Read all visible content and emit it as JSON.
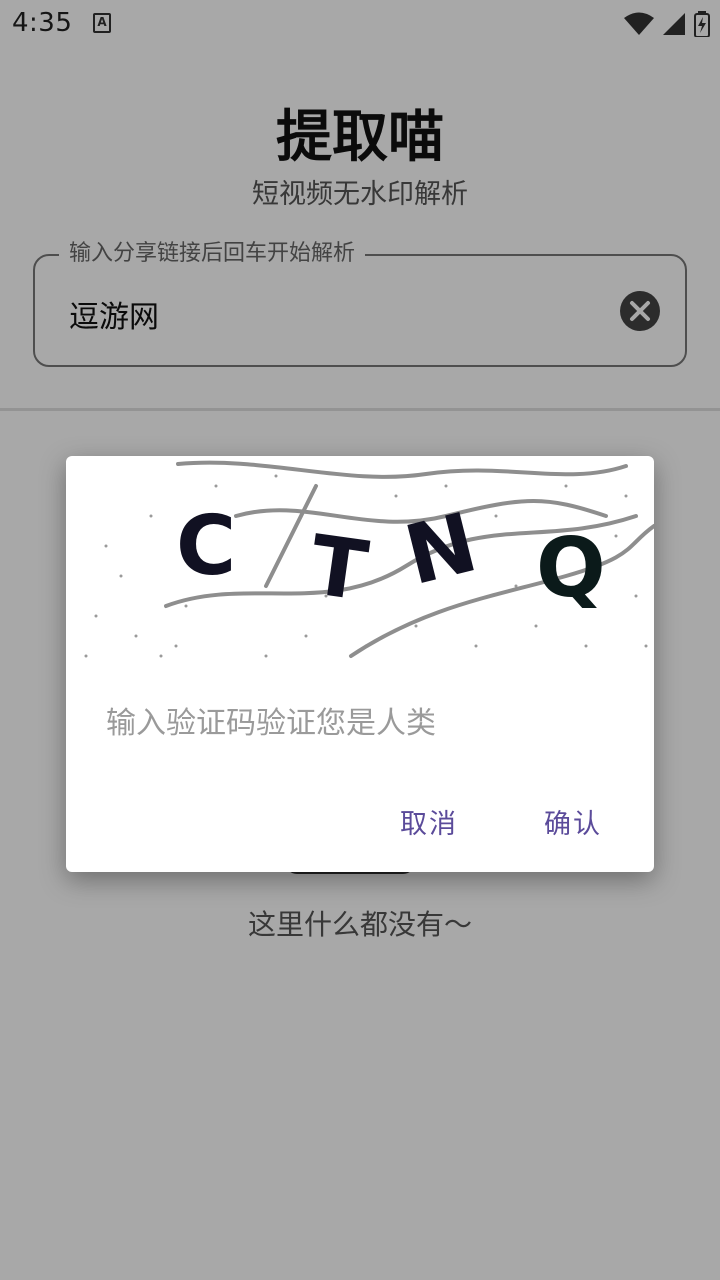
{
  "status_bar": {
    "time": "4:35",
    "notif_icon": "font-a-icon",
    "icons": [
      "wifi-icon",
      "signal-icon",
      "battery-charging-icon"
    ]
  },
  "app": {
    "title": "提取喵",
    "subtitle": "短视频无水印解析"
  },
  "link_field": {
    "label": "输入分享链接后回车开始解析",
    "value": "逗游网",
    "clear_icon": "clear-circle-icon"
  },
  "empty_state": {
    "text": "这里什么都没有～"
  },
  "dialog": {
    "captcha_text": "CTNQ",
    "captcha_letters": [
      "C",
      "T",
      "N",
      "Q"
    ],
    "input_placeholder": "输入验证码验证您是人类",
    "input_value": "",
    "cancel_label": "取消",
    "confirm_label": "确认"
  },
  "colors": {
    "accent": "#5b4b9a",
    "scrim": "rgba(0,0,0,0.34)"
  }
}
